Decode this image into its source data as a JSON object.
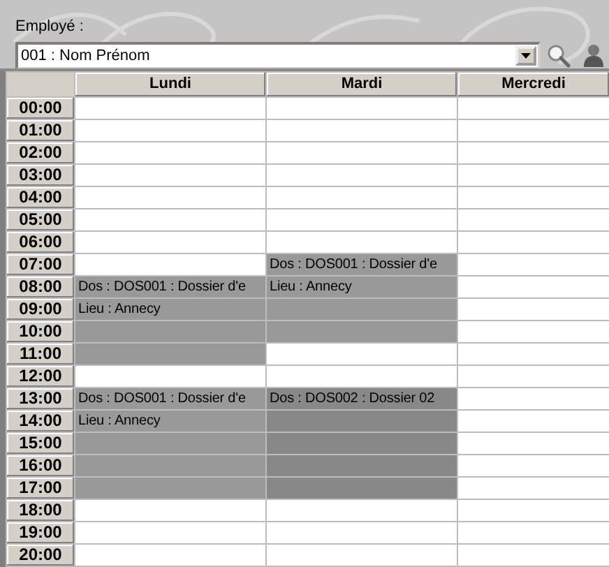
{
  "employee": {
    "label": "Employé :",
    "value": "001 : Nom Prénom"
  },
  "days": [
    "Lundi",
    "Mardi",
    "Mercredi"
  ],
  "rows": [
    {
      "time": "00:00",
      "cells": [
        {
          "kind": "free"
        },
        {
          "kind": "free"
        },
        {
          "kind": "free"
        }
      ]
    },
    {
      "time": "01:00",
      "cells": [
        {
          "kind": "free"
        },
        {
          "kind": "free"
        },
        {
          "kind": "free"
        }
      ]
    },
    {
      "time": "02:00",
      "cells": [
        {
          "kind": "free"
        },
        {
          "kind": "free"
        },
        {
          "kind": "free"
        }
      ]
    },
    {
      "time": "03:00",
      "cells": [
        {
          "kind": "free"
        },
        {
          "kind": "free"
        },
        {
          "kind": "free"
        }
      ]
    },
    {
      "time": "04:00",
      "cells": [
        {
          "kind": "free"
        },
        {
          "kind": "free"
        },
        {
          "kind": "free"
        }
      ]
    },
    {
      "time": "05:00",
      "cells": [
        {
          "kind": "free"
        },
        {
          "kind": "free"
        },
        {
          "kind": "free"
        }
      ]
    },
    {
      "time": "06:00",
      "cells": [
        {
          "kind": "free"
        },
        {
          "kind": "free"
        },
        {
          "kind": "free"
        }
      ]
    },
    {
      "time": "07:00",
      "cells": [
        {
          "kind": "free"
        },
        {
          "kind": "booked",
          "color": "#999999",
          "text": "Dos : DOS001 : Dossier d'e"
        },
        {
          "kind": "free"
        }
      ]
    },
    {
      "time": "08:00",
      "cells": [
        {
          "kind": "booked",
          "color": "#999999",
          "text": "Dos : DOS001 : Dossier d'e"
        },
        {
          "kind": "booked",
          "color": "#999999",
          "text": "Lieu : Annecy"
        },
        {
          "kind": "free"
        }
      ]
    },
    {
      "time": "09:00",
      "cells": [
        {
          "kind": "booked",
          "color": "#999999",
          "text": "Lieu : Annecy"
        },
        {
          "kind": "booked",
          "color": "#999999"
        },
        {
          "kind": "free"
        }
      ]
    },
    {
      "time": "10:00",
      "cells": [
        {
          "kind": "booked",
          "color": "#999999"
        },
        {
          "kind": "booked",
          "color": "#999999"
        },
        {
          "kind": "free"
        }
      ]
    },
    {
      "time": "11:00",
      "cells": [
        {
          "kind": "booked",
          "color": "#999999"
        },
        {
          "kind": "free"
        },
        {
          "kind": "free"
        }
      ]
    },
    {
      "time": "12:00",
      "cells": [
        {
          "kind": "free"
        },
        {
          "kind": "free"
        },
        {
          "kind": "free"
        }
      ]
    },
    {
      "time": "13:00",
      "cells": [
        {
          "kind": "booked",
          "color": "#999999",
          "text": "Dos : DOS001 : Dossier d'e"
        },
        {
          "kind": "booked",
          "color": "#888888",
          "text": "Dos : DOS002 : Dossier 02"
        },
        {
          "kind": "free"
        }
      ]
    },
    {
      "time": "14:00",
      "cells": [
        {
          "kind": "booked",
          "color": "#999999",
          "text": "Lieu : Annecy"
        },
        {
          "kind": "booked",
          "color": "#888888"
        },
        {
          "kind": "free"
        }
      ]
    },
    {
      "time": "15:00",
      "cells": [
        {
          "kind": "booked",
          "color": "#999999"
        },
        {
          "kind": "booked",
          "color": "#888888"
        },
        {
          "kind": "free"
        }
      ]
    },
    {
      "time": "16:00",
      "cells": [
        {
          "kind": "booked",
          "color": "#999999"
        },
        {
          "kind": "booked",
          "color": "#888888"
        },
        {
          "kind": "free"
        }
      ]
    },
    {
      "time": "17:00",
      "cells": [
        {
          "kind": "booked",
          "color": "#999999"
        },
        {
          "kind": "booked",
          "color": "#888888"
        },
        {
          "kind": "free"
        }
      ]
    },
    {
      "time": "18:00",
      "cells": [
        {
          "kind": "free"
        },
        {
          "kind": "free"
        },
        {
          "kind": "free"
        }
      ]
    },
    {
      "time": "19:00",
      "cells": [
        {
          "kind": "free"
        },
        {
          "kind": "free"
        },
        {
          "kind": "free"
        }
      ]
    },
    {
      "time": "20:00",
      "cells": [
        {
          "kind": "free"
        },
        {
          "kind": "free"
        },
        {
          "kind": "free"
        }
      ]
    }
  ]
}
